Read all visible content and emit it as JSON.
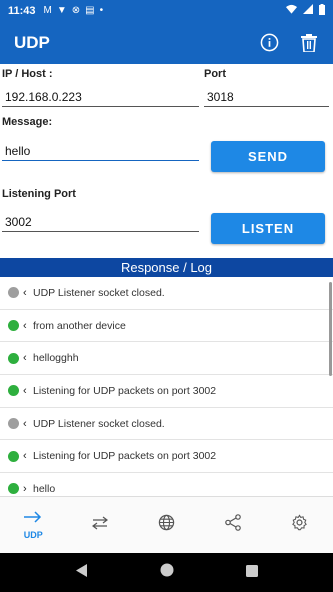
{
  "status_bar": {
    "time": "11:43",
    "notif_icons": [
      "gmail-icon",
      "shield-icon",
      "vpn-icon",
      "cast-icon"
    ]
  },
  "app_bar": {
    "title": "UDP"
  },
  "form": {
    "ip_label": "IP / Host :",
    "ip_value": "192.168.0.223",
    "port_label": "Port",
    "port_value": "3018",
    "message_label": "Message:",
    "message_value": "hello",
    "send_label": "SEND",
    "listen_port_label": "Listening Port",
    "listen_port_value": "3002",
    "listen_label": "LISTEN"
  },
  "log": {
    "header": "Response / Log",
    "items": [
      {
        "status": "gray",
        "direction": "in",
        "text": "UDP Listener socket closed."
      },
      {
        "status": "green",
        "direction": "in",
        "text": "from another device"
      },
      {
        "status": "green",
        "direction": "in",
        "text": "hellogghh"
      },
      {
        "status": "green",
        "direction": "in",
        "text": "Listening for UDP packets on port 3002"
      },
      {
        "status": "gray",
        "direction": "in",
        "text": "UDP Listener socket closed."
      },
      {
        "status": "green",
        "direction": "in",
        "text": "Listening for UDP packets on port 3002"
      },
      {
        "status": "green",
        "direction": "out",
        "text": "hello"
      }
    ]
  },
  "bottom_nav": {
    "active_label": "UDP"
  },
  "colors": {
    "primary": "#1565c0",
    "button": "#1e88e5",
    "header": "#0d47a1",
    "dot_green": "#2eaf3e",
    "dot_gray": "#9e9e9e"
  }
}
